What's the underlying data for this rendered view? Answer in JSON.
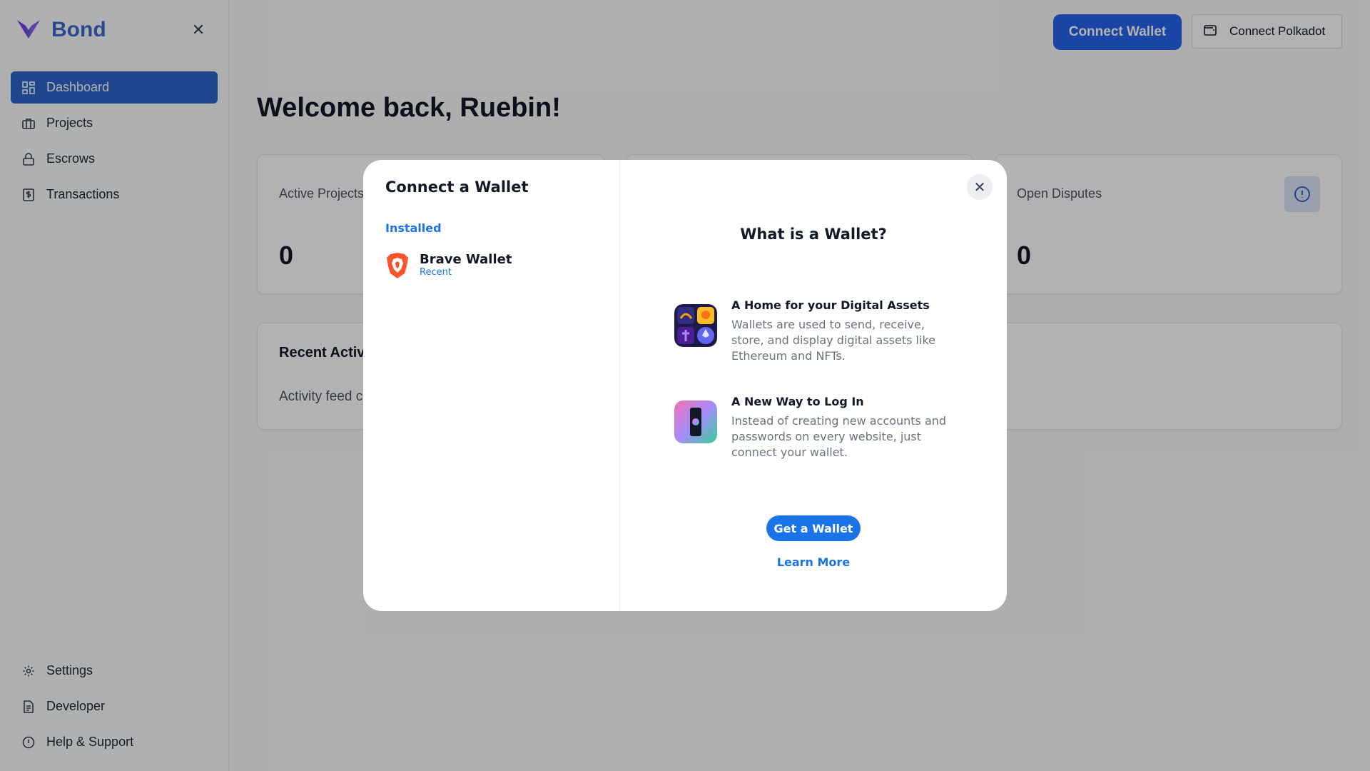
{
  "sidebar": {
    "brand": "Bond",
    "items": [
      {
        "label": "Dashboard",
        "icon": "grid-icon",
        "active": true
      },
      {
        "label": "Projects",
        "icon": "briefcase-icon"
      },
      {
        "label": "Escrows",
        "icon": "lock-icon"
      },
      {
        "label": "Transactions",
        "icon": "receipt-icon"
      }
    ],
    "bottom_items": [
      {
        "label": "Settings",
        "icon": "gear-icon"
      },
      {
        "label": "Developer",
        "icon": "document-icon"
      },
      {
        "label": "Help & Support",
        "icon": "help-icon"
      }
    ]
  },
  "header": {
    "connect_wallet": "Connect Wallet",
    "connect_polkadot": "Connect Polkadot"
  },
  "main": {
    "welcome": "Welcome back, Ruebin!",
    "cards": [
      {
        "label": "Active Projects",
        "value": "0"
      },
      {
        "label": "Open Disputes",
        "value": "0"
      }
    ],
    "recent": {
      "title": "Recent Activity",
      "text": "Activity feed coming soon"
    }
  },
  "modal": {
    "title": "Connect a Wallet",
    "installed_label": "Installed",
    "wallets": [
      {
        "name": "Brave Wallet",
        "sub": "Recent"
      }
    ],
    "what_title": "What is a Wallet?",
    "features": [
      {
        "title": "A Home for your Digital Assets",
        "desc": "Wallets are used to send, receive, store, and display digital assets like Ethereum and NFTs."
      },
      {
        "title": "A New Way to Log In",
        "desc": "Instead of creating new accounts and passwords on every website, just connect your wallet."
      }
    ],
    "get_wallet": "Get a Wallet",
    "learn_more": "Learn More"
  },
  "colors": {
    "brand": "#3b6ad0",
    "primary": "#2563eb",
    "modal_accent": "#1a73e8"
  }
}
